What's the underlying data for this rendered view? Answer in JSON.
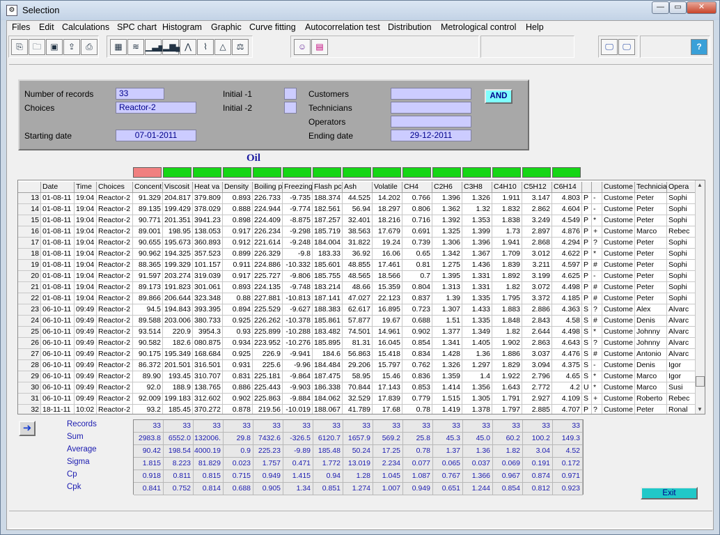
{
  "window": {
    "title": "Selection",
    "min_label": "—",
    "max_label": "▭",
    "close_label": "✕"
  },
  "menu": [
    "Files",
    "Edit",
    "Calculations",
    "SPC chart",
    "Histogram",
    "Graphic",
    "Curve fitting",
    "Autocorrelation test",
    "Distribution",
    "Metrological control",
    "Help"
  ],
  "toolbar": {
    "file_icons": [
      "copy-icon",
      "open-folder-icon",
      "save-icon",
      "export-icon",
      "print-icon"
    ],
    "chart_icons": [
      "calculator-icon",
      "spc-chart-icon",
      "histogram-icon",
      "bar-chart-icon",
      "distribution-icon",
      "control-chart-icon",
      "curve-icon",
      "balance-icon"
    ],
    "extra_icons": [
      "user-icon",
      "calendar-icon"
    ],
    "view_icons": [
      "monitor-icon",
      "monitor-alt-icon"
    ],
    "help_icon": "help-icon"
  },
  "filter": {
    "records_label": "Number of records",
    "records_value": "33",
    "choices_label": "Choices",
    "choices_value": "Reactor-2",
    "initial1_label": "Initial -1",
    "initial2_label": "Initial -2",
    "customers_label": "Customers",
    "technicians_label": "Technicians",
    "operators_label": "Operators",
    "start_label": "Starting date",
    "start_value": "07-01-2011",
    "end_label": "Ending date",
    "end_value": "29-12-2011",
    "product": "Oil",
    "and_label": "AND"
  },
  "indicators": [
    "red",
    "green",
    "green",
    "green",
    "green",
    "green",
    "green",
    "green",
    "green",
    "green",
    "green",
    "green",
    "green",
    "green",
    "green"
  ],
  "indicator_colors": {
    "red": "#f08080",
    "green": "#16d616"
  },
  "grid": {
    "headers": [
      "",
      "Date",
      "Time",
      "Choices",
      "Concent",
      "Viscosit",
      "Heat va",
      "Density",
      "Boiling p",
      "Freezing",
      "Flash pc",
      "Ash",
      "Volatile",
      "CH4",
      "C2H6",
      "C3H8",
      "C4H10",
      "C5H12",
      "C6H14",
      "",
      "",
      "Custome",
      "Technicia",
      "Opera"
    ],
    "rows": [
      [
        "13",
        "01-08-11",
        "19:04",
        "Reactor-2",
        "91.329",
        "204.817",
        "379.809",
        "0.893",
        "226.733",
        "-9.735",
        "188.374",
        "44.525",
        "14.202",
        "0.766",
        "1.396",
        "1.326",
        "1.911",
        "3.147",
        "4.803",
        "P",
        "-",
        "Custome",
        "Peter",
        "Sophi"
      ],
      [
        "14",
        "01-08-11",
        "19:04",
        "Reactor-2",
        "89.135",
        "199.429",
        "378.029",
        "0.888",
        "224.944",
        "-9.774",
        "182.561",
        "56.94",
        "18.297",
        "0.806",
        "1.362",
        "1.32",
        "1.832",
        "2.862",
        "4.604",
        "P",
        "-",
        "Custome",
        "Peter",
        "Sophi"
      ],
      [
        "15",
        "01-08-11",
        "19:04",
        "Reactor-2",
        "90.771",
        "201.351",
        "3941.23",
        "0.898",
        "224.409",
        "-8.875",
        "187.257",
        "32.401",
        "18.216",
        "0.716",
        "1.392",
        "1.353",
        "1.838",
        "3.249",
        "4.549",
        "P",
        "*",
        "Custome",
        "Peter",
        "Sophi"
      ],
      [
        "16",
        "01-08-11",
        "19:04",
        "Reactor-2",
        "89.001",
        "198.95",
        "138.053",
        "0.917",
        "226.234",
        "-9.298",
        "185.719",
        "38.563",
        "17.679",
        "0.691",
        "1.325",
        "1.399",
        "1.73",
        "2.897",
        "4.876",
        "P",
        "+",
        "Custome",
        "Marco",
        "Rebec"
      ],
      [
        "17",
        "01-08-11",
        "19:04",
        "Reactor-2",
        "90.655",
        "195.673",
        "360.893",
        "0.912",
        "221.614",
        "-9.248",
        "184.004",
        "31.822",
        "19.24",
        "0.739",
        "1.306",
        "1.396",
        "1.941",
        "2.868",
        "4.294",
        "P",
        "?",
        "Custome",
        "Peter",
        "Sophi"
      ],
      [
        "18",
        "01-08-11",
        "19:04",
        "Reactor-2",
        "90.962",
        "194.325",
        "357.523",
        "0.899",
        "226.329",
        "-9.8",
        "183.33",
        "36.92",
        "16.06",
        "0.65",
        "1.342",
        "1.367",
        "1.709",
        "3.012",
        "4.622",
        "P",
        "*",
        "Custome",
        "Peter",
        "Sophi"
      ],
      [
        "19",
        "01-08-11",
        "19:04",
        "Reactor-2",
        "88.365",
        "199.329",
        "101.157",
        "0.911",
        "224.886",
        "-10.332",
        "185.601",
        "48.855",
        "17.461",
        "0.81",
        "1.275",
        "1.436",
        "1.839",
        "3.211",
        "4.597",
        "P",
        "#",
        "Custome",
        "Peter",
        "Sophi"
      ],
      [
        "20",
        "01-08-11",
        "19:04",
        "Reactor-2",
        "91.597",
        "203.274",
        "319.039",
        "0.917",
        "225.727",
        "-9.806",
        "185.755",
        "48.565",
        "18.566",
        "0.7",
        "1.395",
        "1.331",
        "1.892",
        "3.199",
        "4.625",
        "P",
        "-",
        "Custome",
        "Peter",
        "Sophi"
      ],
      [
        "21",
        "01-08-11",
        "19:04",
        "Reactor-2",
        "89.173",
        "191.823",
        "301.061",
        "0.893",
        "224.135",
        "-9.748",
        "183.214",
        "48.66",
        "15.359",
        "0.804",
        "1.313",
        "1.331",
        "1.82",
        "3.072",
        "4.498",
        "P",
        "#",
        "Custome",
        "Peter",
        "Sophi"
      ],
      [
        "22",
        "01-08-11",
        "19:04",
        "Reactor-2",
        "89.866",
        "206.644",
        "323.348",
        "0.88",
        "227.881",
        "-10.813",
        "187.141",
        "47.027",
        "22.123",
        "0.837",
        "1.39",
        "1.335",
        "1.795",
        "3.372",
        "4.185",
        "P",
        "#",
        "Custome",
        "Peter",
        "Sophi"
      ],
      [
        "23",
        "06-10-11",
        "09:49",
        "Reactor-2",
        "94.5",
        "194.843",
        "393.395",
        "0.894",
        "225.529",
        "-9.627",
        "188.383",
        "62.617",
        "16.895",
        "0.723",
        "1.307",
        "1.433",
        "1.883",
        "2.886",
        "4.363",
        "S",
        "?",
        "Custome",
        "Alex",
        "Alvarc"
      ],
      [
        "24",
        "06-10-11",
        "09:49",
        "Reactor-2",
        "89.588",
        "203.006",
        "380.733",
        "0.925",
        "226.262",
        "-10.378",
        "185.861",
        "57.877",
        "19.67",
        "0.688",
        "1.51",
        "1.335",
        "1.848",
        "2.843",
        "4.58",
        "S",
        "#",
        "Custome",
        "Denis",
        "Alvarc"
      ],
      [
        "25",
        "06-10-11",
        "09:49",
        "Reactor-2",
        "93.514",
        "220.9",
        "3954.3",
        "0.93",
        "225.899",
        "-10.288",
        "183.482",
        "74.501",
        "14.961",
        "0.902",
        "1.377",
        "1.349",
        "1.82",
        "2.644",
        "4.498",
        "S",
        "*",
        "Custome",
        "Johnny",
        "Alvarc"
      ],
      [
        "26",
        "06-10-11",
        "09:49",
        "Reactor-2",
        "90.582",
        "182.6",
        "080.875",
        "0.934",
        "223.952",
        "-10.276",
        "185.895",
        "81.31",
        "16.045",
        "0.854",
        "1.341",
        "1.405",
        "1.902",
        "2.863",
        "4.643",
        "S",
        "?",
        "Custome",
        "Johnny",
        "Alvarc"
      ],
      [
        "27",
        "06-10-11",
        "09:49",
        "Reactor-2",
        "90.175",
        "195.349",
        "168.684",
        "0.925",
        "226.9",
        "-9.941",
        "184.6",
        "56.863",
        "15.418",
        "0.834",
        "1.428",
        "1.36",
        "1.886",
        "3.037",
        "4.476",
        "S",
        "#",
        "Custome",
        "Antonio",
        "Alvarc"
      ],
      [
        "28",
        "06-10-11",
        "09:49",
        "Reactor-2",
        "86.372",
        "201.501",
        "316.501",
        "0.931",
        "225.6",
        "-9.96",
        "184.484",
        "29.206",
        "15.797",
        "0.762",
        "1.326",
        "1.297",
        "1.829",
        "3.094",
        "4.375",
        "S",
        "-",
        "Custome",
        "Denis",
        "Igor"
      ],
      [
        "29",
        "06-10-11",
        "09:49",
        "Reactor-2",
        "89.90",
        "193.45",
        "310.707",
        "0.831",
        "225.181",
        "-9.864",
        "187.475",
        "58.95",
        "15.46",
        "0.836",
        "1.359",
        "1.4",
        "1.922",
        "2.796",
        "4.65",
        "S",
        "*",
        "Custome",
        "Marco",
        "Igor"
      ],
      [
        "30",
        "06-10-11",
        "09:49",
        "Reactor-2",
        "92.0",
        "188.9",
        "138.765",
        "0.886",
        "225.443",
        "-9.903",
        "186.338",
        "70.844",
        "17.143",
        "0.853",
        "1.414",
        "1.356",
        "1.643",
        "2.772",
        "4.2",
        "U",
        "*",
        "Custome",
        "Marco",
        "Susi"
      ],
      [
        "31",
        "06-10-11",
        "09:49",
        "Reactor-2",
        "92.009",
        "199.183",
        "312.602",
        "0.902",
        "225.863",
        "-9.884",
        "184.062",
        "32.529",
        "17.839",
        "0.779",
        "1.515",
        "1.305",
        "1.791",
        "2.927",
        "4.109",
        "S",
        "+",
        "Custome",
        "Roberto",
        "Rebec"
      ],
      [
        "32",
        "18-11-11",
        "10:02",
        "Reactor-2",
        "93.2",
        "185.45",
        "370.272",
        "0.878",
        "219.56",
        "-10.019",
        "188.067",
        "41.789",
        "17.68",
        "0.78",
        "1.419",
        "1.378",
        "1.797",
        "2.885",
        "4.707",
        "P",
        "?",
        "Custome",
        "Peter",
        "Ronal"
      ]
    ]
  },
  "stats": {
    "labels": [
      "Records",
      "Sum",
      "Average",
      "Sigma",
      "Cp",
      "Cpk"
    ],
    "rows": [
      [
        "33",
        "33",
        "33",
        "33",
        "33",
        "33",
        "33",
        "33",
        "33",
        "33",
        "33",
        "33",
        "33",
        "33",
        "33"
      ],
      [
        "2983.8",
        "6552.0",
        "132006.",
        "29.8",
        "7432.6",
        "-326.5",
        "6120.7",
        "1657.9",
        "569.2",
        "25.8",
        "45.3",
        "45.0",
        "60.2",
        "100.2",
        "149.3"
      ],
      [
        "90.42",
        "198.54",
        "4000.19",
        "0.9",
        "225.23",
        "-9.89",
        "185.48",
        "50.24",
        "17.25",
        "0.78",
        "1.37",
        "1.36",
        "1.82",
        "3.04",
        "4.52"
      ],
      [
        "1.815",
        "8.223",
        "81.829",
        "0.023",
        "1.757",
        "0.471",
        "1.772",
        "13.019",
        "2.234",
        "0.077",
        "0.065",
        "0.037",
        "0.069",
        "0.191",
        "0.172"
      ],
      [
        "0.918",
        "0.811",
        "0.815",
        "0.715",
        "0.949",
        "1.415",
        "0.94",
        "1.28",
        "1.045",
        "1.087",
        "0.767",
        "1.366",
        "0.967",
        "0.874",
        "0.971"
      ],
      [
        "0.841",
        "0.752",
        "0.814",
        "0.688",
        "0.905",
        "1.34",
        "0.851",
        "1.274",
        "1.007",
        "0.949",
        "0.651",
        "1.244",
        "0.854",
        "0.812",
        "0.923"
      ]
    ]
  },
  "exit_label": "Exit",
  "nav_icon": "arrow-right-icon"
}
